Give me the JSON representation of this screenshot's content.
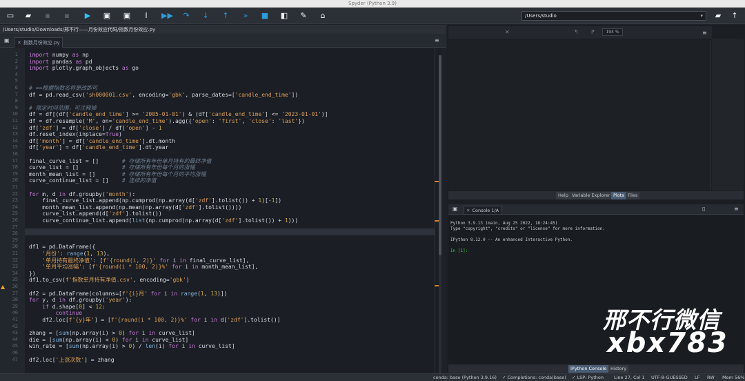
{
  "window": {
    "title": "Spyder (Python 3.9)"
  },
  "toolbar": {
    "working_directory": "/Users/studio",
    "icons": [
      "new-file-icon",
      "open-file-icon",
      "save-icon",
      "save-all-icon",
      "run-icon",
      "run-cell-icon",
      "run-cell-advance-icon",
      "run-selection-icon",
      "debug-icon",
      "step-icon",
      "step-into-icon",
      "step-return-icon",
      "continue-icon",
      "stop-icon",
      "maximize-pane-icon",
      "preferences-icon",
      "python-path-icon"
    ]
  },
  "editor": {
    "file_path": "/Users/studio/Downloads/邢不行——月份效应代码/指数月份效应.py",
    "tab_label": "指数月份效应.py",
    "current_line": 27,
    "warning_line": 36,
    "lines": [
      "<span class=\"k\">import</span> numpy <span class=\"k\">as</span> np",
      "<span class=\"k\">import</span> pandas <span class=\"k\">as</span> pd",
      "<span class=\"k\">import</span> plotly.graph_objects <span class=\"k\">as</span> go",
      "",
      "",
      "<span class=\"c\"># ==根据指数名称更改即可</span>",
      "df = pd.read_csv(<span class=\"s\">'sh000001.csv'</span>, encoding=<span class=\"s\">'gbk'</span>, parse_dates=[<span class=\"s\">'candle_end_time'</span>])",
      "",
      "<span class=\"c\"># 限定时间范围，可注释掉</span>",
      "df = df[(df[<span class=\"s\">'candle_end_time'</span>] >= <span class=\"s\">'2005-01-01'</span>) & (df[<span class=\"s\">'candle_end_time'</span>] <= <span class=\"s\">'2023-01-01'</span>)]",
      "df = df.resample(<span class=\"s\">'M'</span>, on=<span class=\"s\">'candle_end_time'</span>).agg({<span class=\"s\">'open'</span>: <span class=\"s\">'first'</span>, <span class=\"s\">'close'</span>: <span class=\"s\">'last'</span>})",
      "df[<span class=\"s\">'zdf'</span>] = df[<span class=\"s\">'close'</span>] / df[<span class=\"s\">'open'</span>] - <span class=\"n\">1</span>",
      "df.reset_index(inplace=<span class=\"k\">True</span>)",
      "df[<span class=\"s\">'month'</span>] = df[<span class=\"s\">'candle_end_time'</span>].dt.month",
      "df[<span class=\"s\">'year'</span>] = df[<span class=\"s\">'candle_end_time'</span>].dt.year",
      "",
      "final_curve_list = []       <span class=\"c\"># 存储所有年份单月持有的最终净值</span>",
      "curve_list = []             <span class=\"c\"># 存储所有年份每个月的涨幅</span>",
      "month_mean_list = []        <span class=\"c\"># 存储所有年份每个月的平均涨幅</span>",
      "curve_continue_list = []    <span class=\"c\"># 连续的净值</span>",
      "",
      "<span class=\"k\">for</span> m, d <span class=\"k\">in</span> df.groupby(<span class=\"s\">'month'</span>):",
      "    final_curve_list.append(np.cumprod(np.array(d[<span class=\"s\">'zdf'</span>].tolist()) + <span class=\"n\">1</span>)[-<span class=\"n\">1</span>])",
      "    month_mean_list.append(np.mean(np.array(d[<span class=\"s\">'zdf'</span>].tolist())))",
      "    curve_list.append(d[<span class=\"s\">'zdf'</span>].tolist())",
      "    curve_continue_list.append(<span class=\"b\">list</span>(np.cumprod(np.array(d[<span class=\"s\">'zdf'</span>].tolist()) + <span class=\"n\">1</span>)))",
      "",
      "",
      "",
      "df1 = pd.DataFrame({",
      "    <span class=\"s\">'月份'</span>: <span class=\"b\">range</span>(<span class=\"n\">1</span>, <span class=\"n\">13</span>),",
      "    <span class=\"s\">'单月持有最终净值'</span>: [<span class=\"s\">f'{round(i, 2)}'</span> <span class=\"k\">for</span> i <span class=\"k\">in</span> final_curve_list],",
      "    <span class=\"s\">'单月平均涨幅'</span>: [<span class=\"s\">f'{round(i * 100, 2)}%'</span> <span class=\"k\">for</span> i <span class=\"k\">in</span> month_mean_list],",
      "})",
      "df1.to_csv(<span class=\"s\">f'指数单月持有净值.csv'</span>, encoding=<span class=\"s\">'gbk'</span>)",
      "",
      "df2 = pd.DataFrame(columns=[<span class=\"s\">f'{i}月'</span> <span class=\"k\">for</span> i <span class=\"k\">in</span> <span class=\"b\">range</span>(<span class=\"n\">1</span>, <span class=\"n\">13</span>)])",
      "<span class=\"k\">for</span> y, d <span class=\"k\">in</span> df.groupby(<span class=\"s\">'year'</span>):",
      "    <span class=\"k\">if</span> d.shape[<span class=\"n\">0</span>] < <span class=\"n\">12</span>:",
      "        <span class=\"k\">continue</span>",
      "    df2.loc[<span class=\"s\">f'{y}年'</span>] = [<span class=\"s\">f'{round(i * 100, 2)}%'</span> <span class=\"k\">for</span> i <span class=\"k\">in</span> d[<span class=\"s\">'zdf'</span>].tolist()]",
      "",
      "zhang = [<span class=\"b\">sum</span>(np.array(i) > <span class=\"n\">0</span>) <span class=\"k\">for</span> i <span class=\"k\">in</span> curve_list]",
      "die = [<span class=\"b\">sum</span>(np.array(i) < <span class=\"n\">0</span>) <span class=\"k\">for</span> i <span class=\"k\">in</span> curve_list]",
      "win_rate = [<span class=\"b\">sum</span>(np.array(i) > <span class=\"n\">0</span>) / <span class=\"b\">len</span>(i) <span class=\"k\">for</span> i <span class=\"k\">in</span> curve_list]",
      "",
      "df2.loc[<span class=\"s\">'上涨次数'</span>] = zhang"
    ]
  },
  "plots": {
    "zoom": "194 %",
    "tabs": [
      "Help",
      "Variable Explorer",
      "Plots",
      "Files"
    ],
    "active_tab": "Plots"
  },
  "console": {
    "tab_label": "Console 1/A",
    "lines": [
      "Python 3.9.13 (main, Aug 25 2022, 18:24:45)",
      "Type \"copyright\", \"credits\" or \"license\" for more information.",
      "",
      "IPython 8.12.0 -- An enhanced Interactive Python.",
      "",
      "In [1]:"
    ],
    "tabs": [
      "IPython Console",
      "History"
    ],
    "active_tab": "IPython Console"
  },
  "watermark": {
    "line1": "邢不行微信",
    "line2": "xbx783"
  },
  "status": {
    "conda": "conda: base (Python 3.9.16)",
    "completions": "✓ Completions: conda(base)",
    "lsp": "✓ LSP: Python",
    "position": "Line 27, Col 1",
    "encoding": "UTF-8-GUESSED",
    "eol": "LF",
    "permissions": "RW",
    "memory": "Mem 56%"
  }
}
